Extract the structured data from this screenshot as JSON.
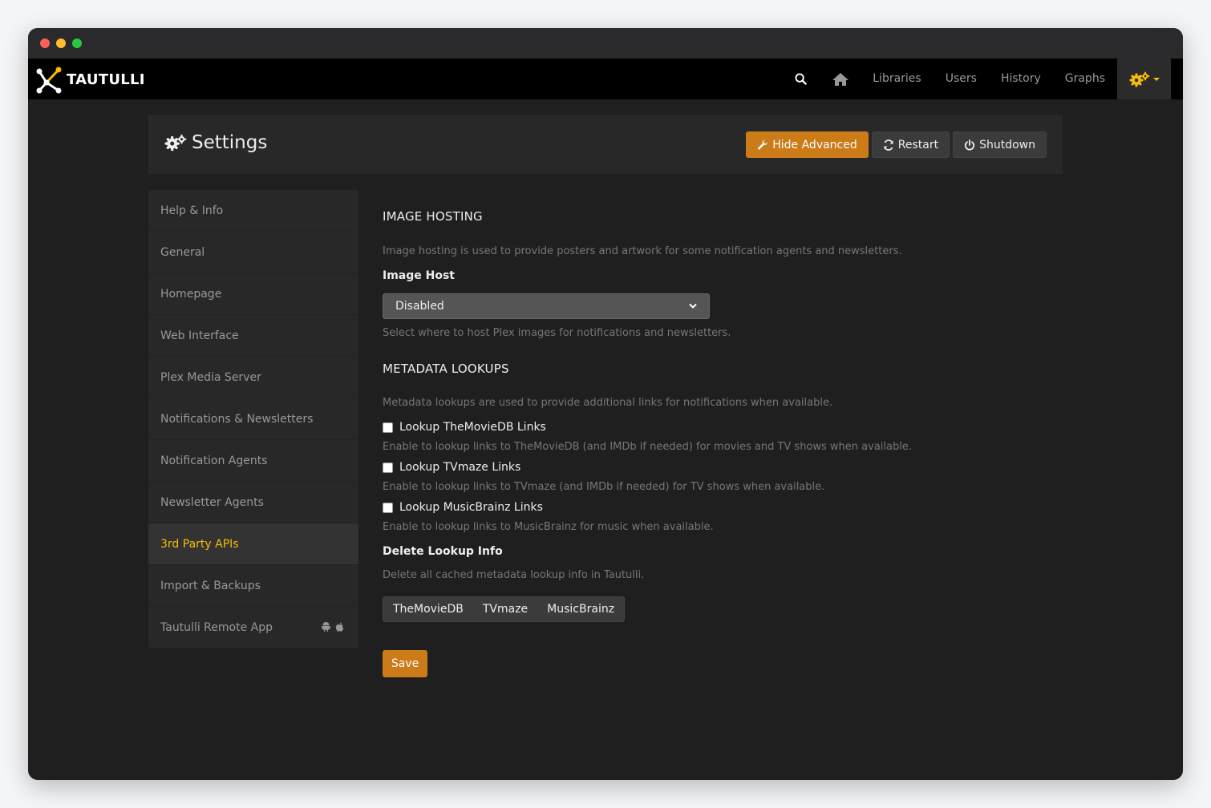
{
  "brand": {
    "name": "TAUTULLI"
  },
  "nav": {
    "links": [
      "Libraries",
      "Users",
      "History",
      "Graphs"
    ],
    "icons": [
      "search-icon",
      "home-icon",
      "gears-icon"
    ],
    "accent": "#f9be03"
  },
  "header": {
    "title": "Settings",
    "buttons": {
      "hide_advanced": "Hide Advanced",
      "restart": "Restart",
      "shutdown": "Shutdown"
    }
  },
  "sidebar": {
    "items": [
      "Help & Info",
      "General",
      "Homepage",
      "Web Interface",
      "Plex Media Server",
      "Notifications & Newsletters",
      "Notification Agents",
      "Newsletter Agents",
      "3rd Party APIs",
      "Import & Backups",
      "Tautulli Remote App"
    ],
    "active": "3rd Party APIs"
  },
  "image_hosting": {
    "title": "IMAGE HOSTING",
    "description": "Image hosting is used to provide posters and artwork for some notification agents and newsletters.",
    "host_label": "Image Host",
    "host_value": "Disabled",
    "host_help": "Select where to host Plex images for notifications and newsletters."
  },
  "metadata": {
    "title": "METADATA LOOKUPS",
    "description": "Metadata lookups are used to provide additional links for notifications when available.",
    "tmdb_label": "Lookup TheMovieDB Links",
    "tmdb_help": "Enable to lookup links to TheMovieDB (and IMDb if needed) for movies and TV shows when available.",
    "tvmaze_label": "Lookup TVmaze Links",
    "tvmaze_help": "Enable to lookup links to TVmaze (and IMDb if needed) for TV shows when available.",
    "musicbrainz_label": "Lookup MusicBrainz Links",
    "musicbrainz_help": "Enable to lookup links to MusicBrainz for music when available.",
    "delete_label": "Delete Lookup Info",
    "delete_help": "Delete all cached metadata lookup info in Tautulli.",
    "delete_buttons": [
      "TheMovieDB",
      "TVmaze",
      "MusicBrainz"
    ]
  },
  "save_label": "Save"
}
